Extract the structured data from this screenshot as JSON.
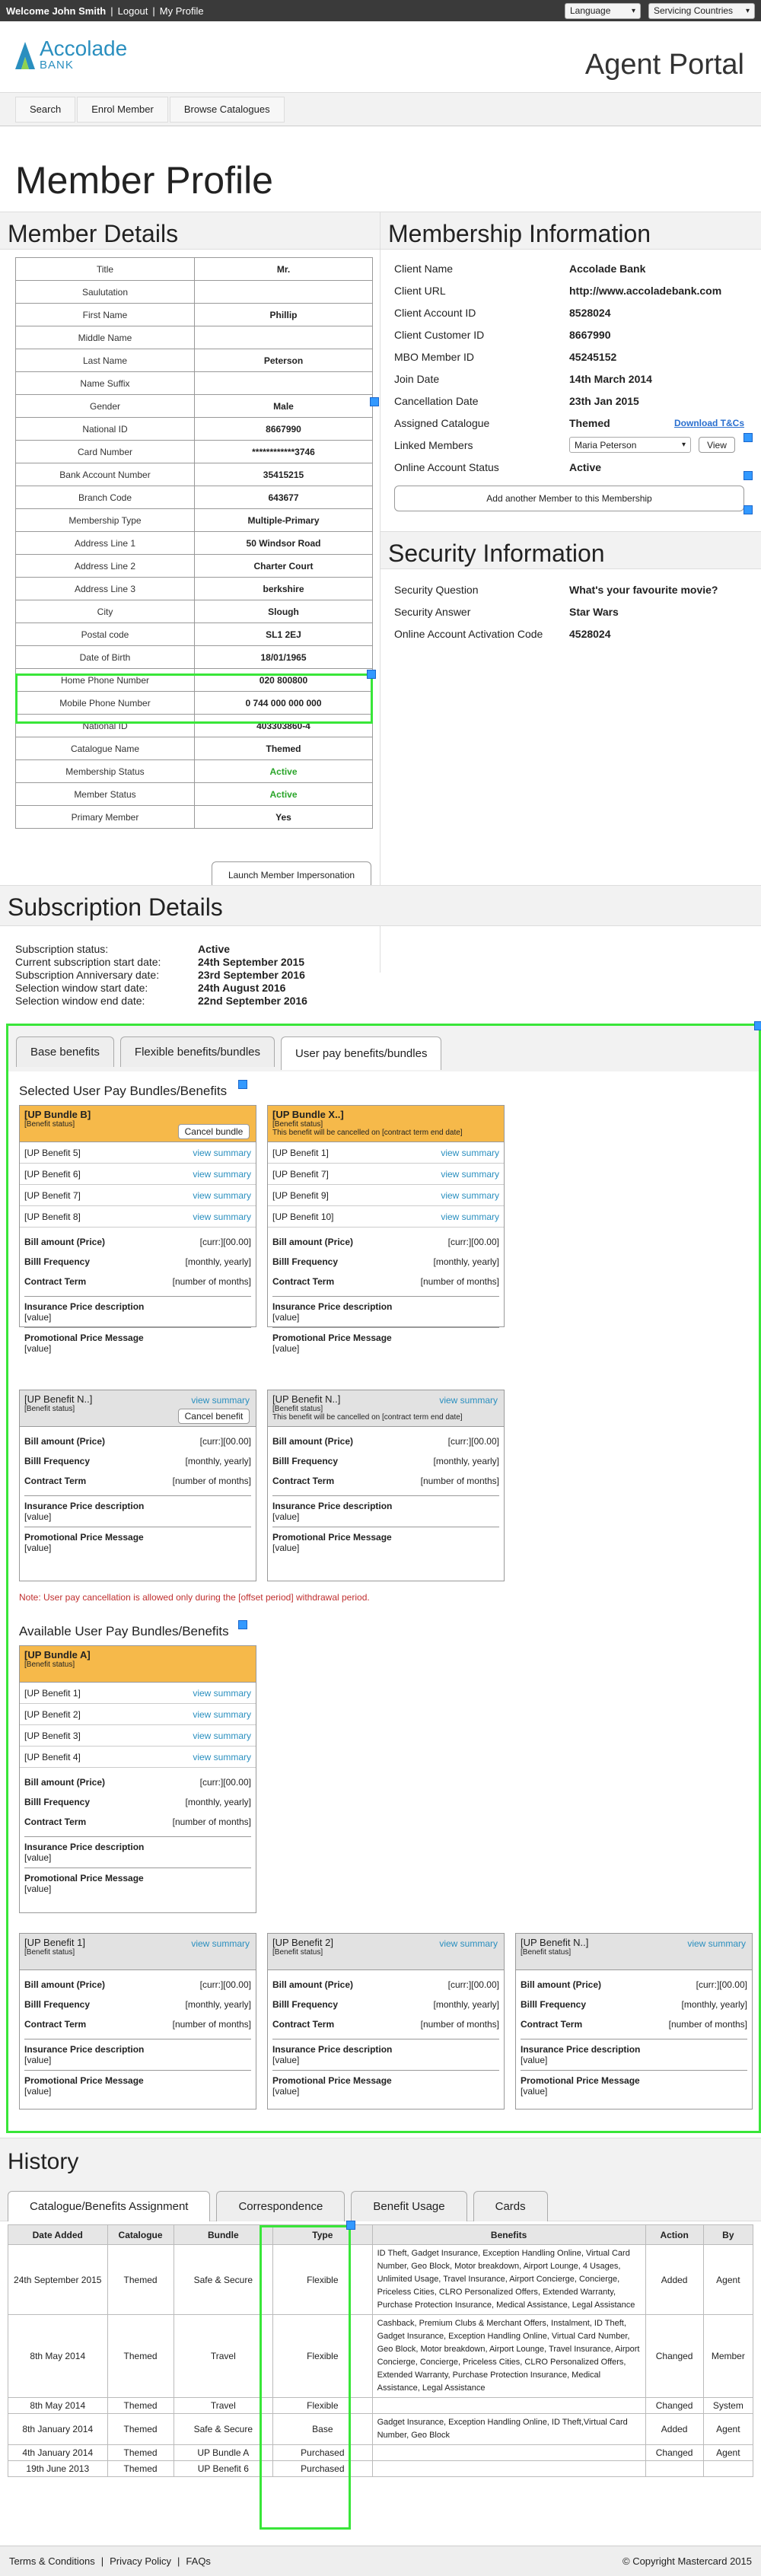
{
  "topbar": {
    "welcome": "Welcome John Smith",
    "logout": "Logout",
    "my_profile": "My Profile",
    "language": "Language",
    "servicing_countries": "Servicing Countries"
  },
  "header": {
    "logo_line1": "Accolade",
    "logo_line2": "BANK",
    "portal_title": "Agent Portal"
  },
  "nav": [
    "Search",
    "Enrol Member",
    "Browse Catalogues"
  ],
  "page_title": "Member Profile",
  "member_details": {
    "heading": "Member Details",
    "rows": [
      {
        "k": "Title",
        "v": "Mr."
      },
      {
        "k": "Saulutation",
        "v": ""
      },
      {
        "k": "First Name",
        "v": "Phillip"
      },
      {
        "k": "Middle Name",
        "v": ""
      },
      {
        "k": "Last Name",
        "v": "Peterson"
      },
      {
        "k": "Name Suffix",
        "v": ""
      },
      {
        "k": "Gender",
        "v": "Male"
      },
      {
        "k": "National ID",
        "v": "8667990"
      },
      {
        "k": "Card Number",
        "v": "************3746"
      },
      {
        "k": "Bank Account Number",
        "v": "35415215"
      },
      {
        "k": "Branch Code",
        "v": "643677"
      },
      {
        "k": "Membership Type",
        "v": "Multiple-Primary"
      },
      {
        "k": "Address Line 1",
        "v": "50 Windsor Road"
      },
      {
        "k": "Address Line 2",
        "v": "Charter Court"
      },
      {
        "k": "Address Line 3",
        "v": "berkshire"
      },
      {
        "k": "City",
        "v": "Slough"
      },
      {
        "k": "Postal code",
        "v": "SL1 2EJ"
      },
      {
        "k": "Date of Birth",
        "v": "18/01/1965"
      },
      {
        "k": "Home Phone Number",
        "v": "020 800800"
      },
      {
        "k": "Mobile Phone Number",
        "v": "0 744 000 000 000"
      },
      {
        "k": "National ID",
        "v": "403303860-4"
      },
      {
        "k": "Catalogue Name",
        "v": "Themed"
      },
      {
        "k": "Membership Status",
        "v": "Active"
      },
      {
        "k": "Member Status",
        "v": "Active"
      },
      {
        "k": "Primary Member",
        "v": "Yes"
      }
    ],
    "launch_button": "Launch Member Impersonation"
  },
  "membership_info": {
    "heading": "Membership Information",
    "rows": [
      {
        "k": "Client Name",
        "v": "Accolade Bank"
      },
      {
        "k": "Client URL",
        "v": "http://www.accoladebank.com"
      },
      {
        "k": "Client Account ID",
        "v": "8528024"
      },
      {
        "k": "Client Customer ID",
        "v": "8667990"
      },
      {
        "k": "MBO Member ID",
        "v": "45245152"
      },
      {
        "k": "Join Date",
        "v": "14th March 2014"
      },
      {
        "k": "Cancellation Date",
        "v": "23th Jan 2015"
      },
      {
        "k": "Assigned Catalogue",
        "v": "Themed"
      }
    ],
    "download_tcs": "Download T&Cs",
    "linked_members_label": "Linked Members",
    "linked_member_value": "Maria Peterson",
    "view_button": "View",
    "online_status_label": "Online Account Status",
    "online_status_value": "Active",
    "add_member_button": "Add another Member to this Membership"
  },
  "security_info": {
    "heading": "Security Information",
    "rows": [
      {
        "k": "Security Question",
        "v": "What's your favourite movie?"
      },
      {
        "k": "Security Answer",
        "v": "Star Wars"
      },
      {
        "k": "Online Account Activation Code",
        "v": "4528024"
      }
    ]
  },
  "subscription": {
    "heading": "Subscription  Details",
    "rows": [
      {
        "k": "Subscription status:",
        "v": "Active"
      },
      {
        "k": "Current subscription start date:",
        "v": "24th September 2015"
      },
      {
        "k": "Subscription Anniversary date:",
        "v": "23rd September 2016"
      },
      {
        "k": "Selection window start date:",
        "v": "24th August 2016"
      },
      {
        "k": "Selection window end date:",
        "v": "22nd September 2016"
      }
    ]
  },
  "benefit_tabs": [
    "Base benefits",
    "Flexible benefits/bundles",
    "User pay benefits/bundles"
  ],
  "selected_heading": "Selected User Pay Bundles/Benefits",
  "available_heading": "Available User Pay Bundles/Benefits",
  "note": "Note: User pay cancellation is allowed only during the [offset period] withdrawal period.",
  "card_common": {
    "benefit_status": "[Benefit status]",
    "view_summary": "view summary",
    "bill_amount": "Bill amount (Price)",
    "bill_amount_v": "[curr:][00.00]",
    "bill_freq": "Billl Frequency",
    "bill_freq_v": "[monthly, yearly]",
    "contract_term": "Contract Term",
    "contract_term_v": "[number of months]",
    "ins_desc": "Insurance Price description",
    "promo": "Promotional Price Message",
    "value": "[value]",
    "cancel_bundle": "Cancel bundle",
    "cancel_benefit": "Cancel benefit",
    "cancel_note": "This benefit will be cancelled on [contract term end date]"
  },
  "cards": {
    "bundle_b": {
      "title": "[UP Bundle B]",
      "benefits": [
        "[UP Benefit 5]",
        "[UP Benefit 6]",
        "[UP Benefit 7]",
        "[UP Benefit 8]"
      ]
    },
    "bundle_x": {
      "title": "[UP Bundle X..]",
      "benefits": [
        "[UP Benefit 1]",
        "[UP Benefit 7]",
        "[UP Benefit 9]",
        "[UP Benefit 10]"
      ]
    },
    "benefit_n1": {
      "title": "[UP Benefit N..]"
    },
    "benefit_n2": {
      "title": "[UP Benefit N..]"
    },
    "bundle_a": {
      "title": "[UP Bundle A]",
      "benefits": [
        "[UP Benefit 1]",
        "[UP Benefit 2]",
        "[UP Benefit 3]",
        "[UP Benefit 4]"
      ]
    },
    "avail_b1": {
      "title": "[UP Benefit 1]"
    },
    "avail_b2": {
      "title": "[UP Benefit 2]"
    },
    "avail_bn": {
      "title": "[UP Benefit N..]"
    }
  },
  "history": {
    "heading": "History",
    "tabs": [
      "Catalogue/Benefits Assignment",
      "Correspondence",
      "Benefit Usage",
      "Cards"
    ],
    "columns": [
      "Date Added",
      "Catalogue",
      "Bundle",
      "Type",
      "Benefits",
      "Action",
      "By"
    ],
    "rows": [
      {
        "date": "24th September 2015",
        "catalogue": "Themed",
        "bundle": "Safe & Secure",
        "type": "Flexible",
        "benefits": "ID Theft, Gadget Insurance, Exception Handling Online, Virtual Card Number, Geo Block, Motor breakdown, Airport Lounge, 4 Usages, Unlimited Usage, Travel Insurance, Airport Concierge, Concierge, Priceless Cities, CLRO Personalized Offers, Extended Warranty, Purchase Protection Insurance, Medical Assistance, Legal Assistance",
        "action": "Added",
        "by": "Agent"
      },
      {
        "date": "8th May 2014",
        "catalogue": "Themed",
        "bundle": "Travel",
        "type": "Flexible",
        "benefits": "Cashback, Premium Clubs & Merchant Offers, Instalment, ID Theft, Gadget Insurance, Exception Handling Online, Virtual Card Number, Geo Block, Motor breakdown, Airport Lounge, Travel Insurance, Airport Concierge, Concierge, Priceless Cities, CLRO Personalized Offers, Extended Warranty, Purchase Protection Insurance, Medical Assistance, Legal Assistance",
        "action": "Changed",
        "by": "Member"
      },
      {
        "date": "8th May 2014",
        "catalogue": "Themed",
        "bundle": "Travel",
        "type": "Flexible",
        "benefits": "",
        "action": "Changed",
        "by": "System"
      },
      {
        "date": "8th January 2014",
        "catalogue": "Themed",
        "bundle": "Safe & Secure",
        "type": "Base",
        "benefits": "Gadget Insurance, Exception Handling Online, ID Theft,Virtual Card Number, Geo Block",
        "action": "Added",
        "by": "Agent"
      },
      {
        "date": "4th January 2014",
        "catalogue": "Themed",
        "bundle": "UP Bundle A",
        "type": "Purchased",
        "benefits": "",
        "action": "Changed",
        "by": "Agent"
      },
      {
        "date": "19th June 2013",
        "catalogue": "Themed",
        "bundle": "UP Benefit 6",
        "type": "Purchased",
        "benefits": "",
        "action": "",
        "by": ""
      }
    ]
  },
  "footer": {
    "links": [
      "Terms & Conditions",
      "Privacy Policy",
      "FAQs"
    ],
    "copyright": "© Copyright Mastercard 2015"
  }
}
